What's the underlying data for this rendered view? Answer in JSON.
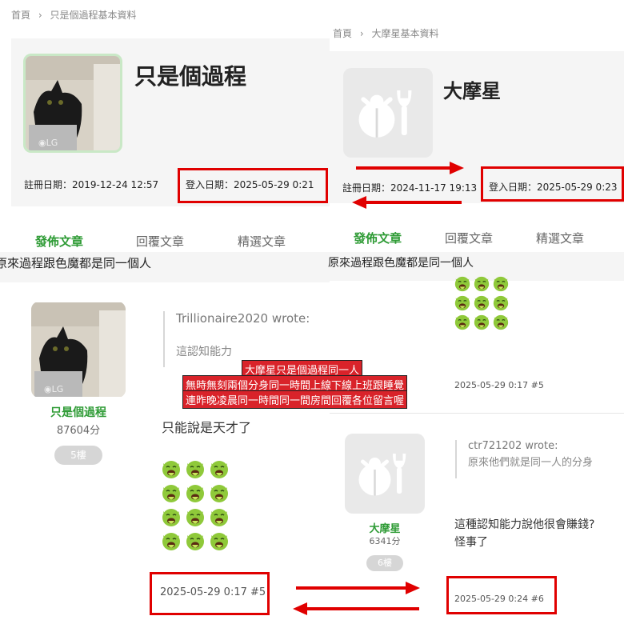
{
  "left_profile": {
    "breadcrumb_home": "首頁",
    "breadcrumb_sep": "›",
    "breadcrumb_page": "只是個過程基本資料",
    "name": "只是個過程",
    "register_text": "註冊日期：2019-12-24 12:57",
    "login_text": "登入日期：2025-05-29 0:21",
    "tabs": [
      "發佈文章",
      "回覆文章",
      "精選文章"
    ],
    "thread_title": "原來過程跟色魔都是同一個人"
  },
  "right_profile": {
    "breadcrumb_home": "首頁",
    "breadcrumb_sep": "›",
    "breadcrumb_page": "大摩星基本資料",
    "name": "大摩星",
    "register_text": "註冊日期：2024-11-17 19:13",
    "login_text": "登入日期：2025-05-29 0:23",
    "tabs": [
      "發佈文章",
      "回覆文章",
      "精選文章"
    ],
    "thread_title": "原來過程跟色魔都是同一個人"
  },
  "left_post": {
    "username": "只是個過程",
    "score": "87604分",
    "floor": "5樓",
    "quote_author": "Trillionaire2020 wrote:",
    "quote_text": "這認知能力",
    "body": "只能說是天才了",
    "timestamp": "2025-05-29 0:17 #5"
  },
  "right_post_prev": {
    "timestamp": "2025-05-29 0:17 #5"
  },
  "right_post": {
    "username": "大摩星",
    "score": "6341分",
    "floor": "6樓",
    "quote_author": "ctr721202 wrote:",
    "quote_text": "原來他們就是同一人的分身",
    "body_line1": "這種認知能力說他很會賺錢?",
    "body_line2": "怪事了",
    "timestamp": "2025-05-29 0:24 #6"
  },
  "annotation": {
    "line1": "大摩星只是個過程同一人",
    "line2": "無時無刻兩個分身同一時間上線下線上班跟睡覺",
    "line3": "連昨晚凌晨同一時間同一間房間回覆各位留言喔"
  },
  "icons": {
    "emoji": "vomiting-face-icon",
    "default_avatar": "ladybug-wrench-icon"
  },
  "colors": {
    "accent_green": "#2e9b35",
    "highlight_red": "#e00000",
    "annotation_red": "#d9232a"
  }
}
